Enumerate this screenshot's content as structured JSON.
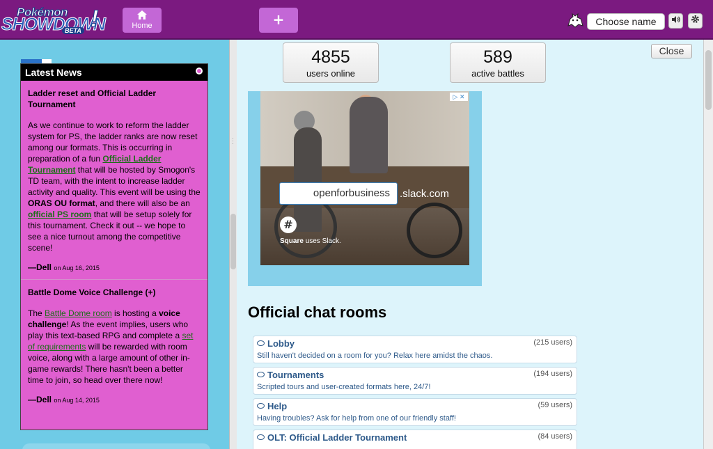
{
  "header": {
    "logo": {
      "line1": "Pokémon",
      "line2": "SHOWDOWN",
      "badge": "BETA",
      "bang": "!"
    },
    "home_label": "Home",
    "home_icon": "house-icon",
    "plus_label": "+",
    "choose_name": "Choose name",
    "sound_icon": "speaker-icon",
    "settings_icon": "gear-icon",
    "bg_color": "#7b1a80",
    "button_color": "#c367d6"
  },
  "news": {
    "title": "Latest News",
    "items": [
      {
        "title": "Ladder reset and Official Ladder Tournament",
        "t1": "As we continue to work to reform the ladder system for PS, the ladder ranks are now reset among our formats. This is occurring in preparation of a fun ",
        "link1": "Official Ladder Tournament",
        "t2": " that will be hosted by Smogon's TD team, with the intent to increase ladder activity and quality. This event will be using the ",
        "bold1": "ORAS OU format",
        "t3": ", and there will also be an ",
        "link2": "official PS room",
        "t4": " that will be setup solely for this tournament. Check it out -- we hope to see a nice turnout among the competitive scene!",
        "author": "—Dell",
        "date": "on Aug 16, 2015"
      },
      {
        "title": "Battle Dome Voice Challenge (+)",
        "t1": "The ",
        "link1": "Battle Dome room",
        "t2": " is hosting a ",
        "bold1": "voice challenge",
        "t3": "! As the event implies, users who play this text-based RPG and complete a ",
        "link2": "set of requirements",
        "t4": " will be rewarded with room voice, along with a large amount of other in-game rewards! There hasn't been a better time to join, so head over there now!",
        "author": "—Dell",
        "date": "on Aug 14, 2015"
      }
    ]
  },
  "stats": {
    "users_online": "4855",
    "users_online_label": "users online",
    "active_battles": "589",
    "active_battles_label": "active battles"
  },
  "close_label": "Close",
  "ad": {
    "field_text": "openforbusiness",
    "domain": ".slack.com",
    "brand": "Square",
    "tagline": "uses Slack.",
    "adchoices": "▷ ✕"
  },
  "rooms": {
    "title": "Official chat rooms",
    "list": [
      {
        "name": "Lobby",
        "users": "(215 users)",
        "desc": "Still haven't decided on a room for you? Relax here amidst the chaos."
      },
      {
        "name": "Tournaments",
        "users": "(194 users)",
        "desc": "Scripted tours and user-created formats here, 24/7!"
      },
      {
        "name": "Help",
        "users": "(59 users)",
        "desc": "Having troubles? Ask for help from one of our friendly staff!"
      },
      {
        "name": "OLT: Official Ladder Tournament",
        "users": "(84 users)",
        "desc": ""
      }
    ]
  }
}
